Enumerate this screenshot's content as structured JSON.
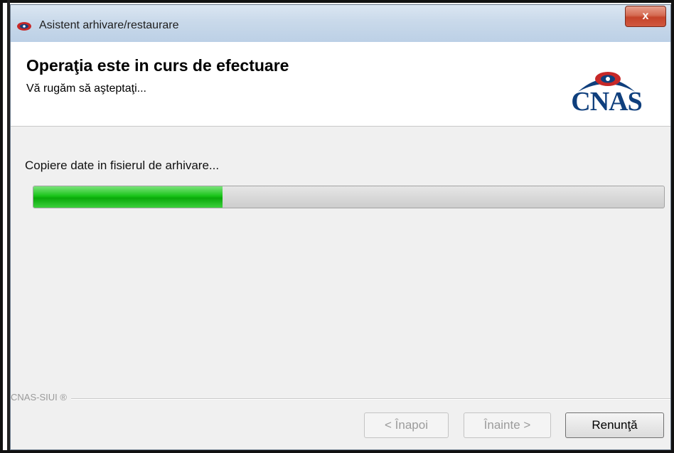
{
  "window": {
    "title": "Asistent arhivare/restaurare",
    "close_label": "x"
  },
  "header": {
    "title": "Operaţia este in curs de efectuare",
    "subtitle": "Vă rugăm să aşteptaţi...",
    "logo_text": "CNAS"
  },
  "progress": {
    "status_text": "Copiere date in fisierul de arhivare...",
    "fraction": 0.3,
    "fill_color": "#19c419"
  },
  "footer": {
    "brand_label": "CNAS-SIUI ®"
  },
  "buttons": {
    "back_label": "< Înapoi",
    "next_label": "Înainte >",
    "cancel_label": "Renunţă"
  }
}
